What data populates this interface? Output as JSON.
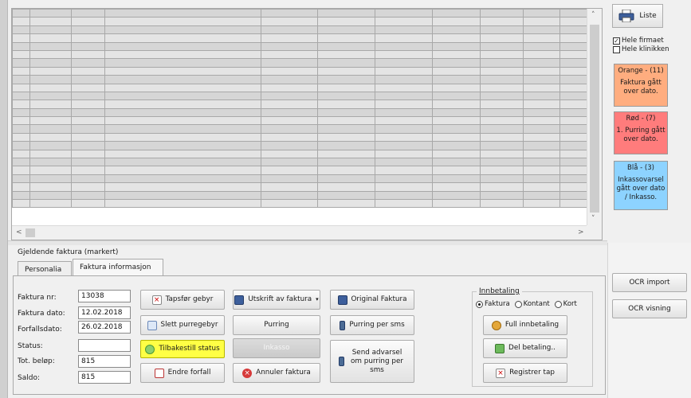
{
  "grid": {
    "rows": 24,
    "columns": 12
  },
  "right_panel": {
    "liste_label": "Liste",
    "checkboxes": [
      {
        "label": "Hele firmaet",
        "checked": true
      },
      {
        "label": "Hele klinikken",
        "checked": false
      }
    ],
    "legend": [
      {
        "title": "Orange - (11)",
        "text": "Faktura gått over dato.",
        "color": "#ffad7f"
      },
      {
        "title": "Rød - (7)",
        "text": "1. Purring gått over dato.",
        "color": "#ff7c7c"
      },
      {
        "title": "Blå - (3)",
        "text": "Inkassovarsel gått over dato / Inkasso.",
        "color": "#8dd3ff"
      }
    ]
  },
  "section_label": "Gjeldende faktura (markert)",
  "tabs": [
    {
      "label": "Personalia",
      "active": false
    },
    {
      "label": "Faktura informasjon",
      "active": true
    }
  ],
  "invoice": {
    "fields": [
      {
        "label": "Faktura nr:",
        "value": "13038"
      },
      {
        "label": "Faktura dato:",
        "value": "12.02.2018"
      },
      {
        "label": "Forfallsdato:",
        "value": "26.02.2018"
      },
      {
        "label": "Status:",
        "value": ""
      },
      {
        "label": "Tot. beløp:",
        "value": "815"
      },
      {
        "label": "Saldo:",
        "value": "815"
      }
    ]
  },
  "buttons": {
    "tapsfor_gebyr": "Tapsfør gebyr",
    "slett_purregebyr": "Slett purregebyr",
    "tilbakestill_status": "Tilbakestill status",
    "endre_forfall": "Endre forfall",
    "utskrift_av_faktura": "Utskrift av faktura",
    "purring": "Purring",
    "inkasso": "Inkasso",
    "annuler_faktura": "Annuler faktura",
    "original_faktura": "Original Faktura",
    "purring_per_sms": "Purring per sms",
    "send_advarsel": "Send advarsel om purring per sms"
  },
  "innbetaling": {
    "title": "Innbetaling",
    "options": [
      {
        "label": "Faktura",
        "selected": true
      },
      {
        "label": "Kontant",
        "selected": false
      },
      {
        "label": "Kort",
        "selected": false
      }
    ],
    "full_innbetaling": "Full innbetaling",
    "del_betaling": "Del betaling..",
    "registrer_tap": "Registrer tap"
  },
  "ocr": {
    "import": "OCR import",
    "visning": "OCR visning"
  },
  "colors": {
    "highlight": "#ffff45",
    "grid_dark": "#d6d6d6",
    "grid_light": "#e4e4e4"
  }
}
